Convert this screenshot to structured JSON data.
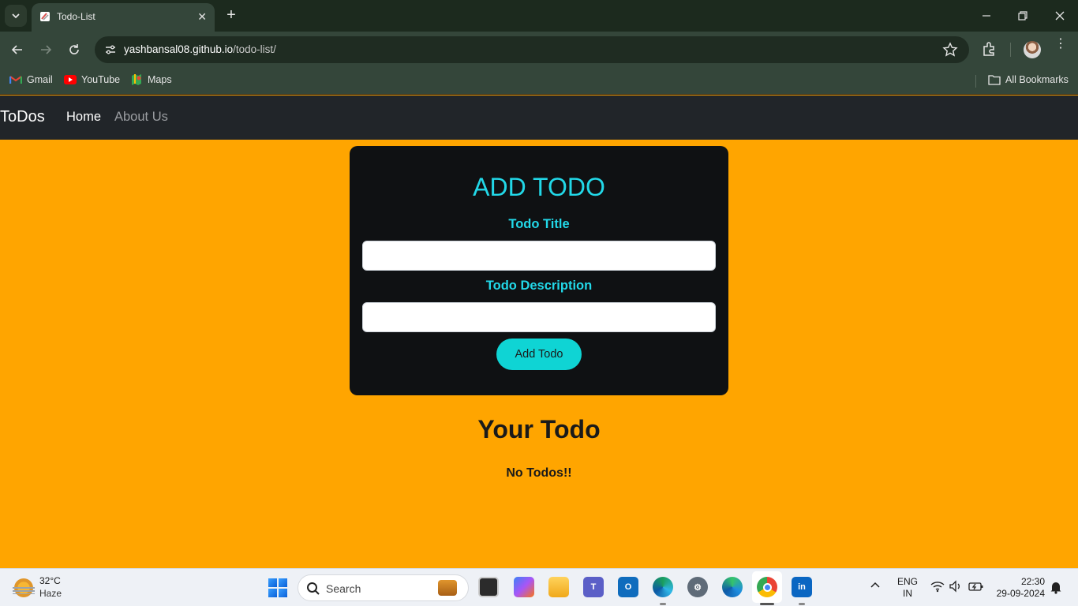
{
  "browser": {
    "tab_title": "Todo-List",
    "url_host": "yashbansal08.github.io",
    "url_path": "/todo-list/",
    "bookmarks": [
      {
        "label": "Gmail",
        "icon": "gmail-icon"
      },
      {
        "label": "YouTube",
        "icon": "youtube-icon"
      },
      {
        "label": "Maps",
        "icon": "maps-icon"
      }
    ],
    "all_bookmarks": "All Bookmarks"
  },
  "navbar": {
    "brand": "ToDos",
    "links": [
      "Home",
      "About Us"
    ]
  },
  "form": {
    "title": "ADD TODO",
    "title_label": "Todo Title",
    "title_value": "",
    "desc_label": "Todo Description",
    "desc_value": "",
    "submit": "Add Todo"
  },
  "list": {
    "heading": "Your Todo",
    "empty_message": "No Todos!!"
  },
  "taskbar": {
    "temperature": "32°C",
    "condition": "Haze",
    "search_placeholder": "Search",
    "lang_top": "ENG",
    "lang_bottom": "IN",
    "time": "22:30",
    "date": "29-09-2024"
  },
  "colors": {
    "page_bg": "#ffa500",
    "navbar_bg": "#212529",
    "card_bg": "#0f1113",
    "accent_cyan": "#22d8e8",
    "button_bg": "#0fd4d4"
  }
}
